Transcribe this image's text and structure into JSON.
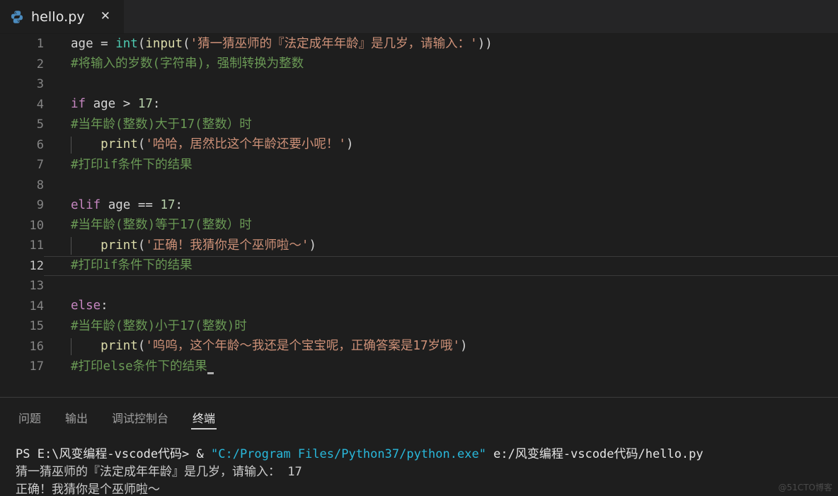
{
  "window": {
    "theme_bg": "#1e1e1e",
    "tabbar_bg": "#252526"
  },
  "tabbar": {
    "tab": {
      "icon": "python-file-icon",
      "label": "hello.py",
      "close_label": "✕"
    }
  },
  "editor": {
    "lines": [
      {
        "n": "1",
        "active": false,
        "indent_guide": false,
        "tokens": [
          {
            "t": "age ",
            "c": "tk-plain"
          },
          {
            "t": "= ",
            "c": "tk-plain"
          },
          {
            "t": "int",
            "c": "tk-fn"
          },
          {
            "t": "(",
            "c": "tk-plain"
          },
          {
            "t": "input",
            "c": "tk-fn2"
          },
          {
            "t": "(",
            "c": "tk-plain"
          },
          {
            "t": "'猜一猜巫师的『法定成年年龄』是几岁，请输入：'",
            "c": "tk-str"
          },
          {
            "t": "))",
            "c": "tk-plain"
          }
        ]
      },
      {
        "n": "2",
        "active": false,
        "indent_guide": false,
        "tokens": [
          {
            "t": "#将输入的岁数(字符串)，强制转换为整数",
            "c": "tk-cmt"
          }
        ]
      },
      {
        "n": "3",
        "active": false,
        "indent_guide": false,
        "tokens": []
      },
      {
        "n": "4",
        "active": false,
        "indent_guide": false,
        "tokens": [
          {
            "t": "if",
            "c": "tk-kw"
          },
          {
            "t": " age ",
            "c": "tk-plain"
          },
          {
            "t": "> ",
            "c": "tk-plain"
          },
          {
            "t": "17",
            "c": "tk-num"
          },
          {
            "t": ":",
            "c": "tk-plain"
          }
        ]
      },
      {
        "n": "5",
        "active": false,
        "indent_guide": false,
        "tokens": [
          {
            "t": "#当年龄(整数)大于17(整数）时",
            "c": "tk-cmt"
          }
        ]
      },
      {
        "n": "6",
        "active": false,
        "indent_guide": true,
        "tokens": [
          {
            "t": "    ",
            "c": "tk-plain"
          },
          {
            "t": "print",
            "c": "tk-fn2"
          },
          {
            "t": "(",
            "c": "tk-plain"
          },
          {
            "t": "'哈哈，居然比这个年龄还要小呢！'",
            "c": "tk-str"
          },
          {
            "t": ")",
            "c": "tk-plain"
          }
        ]
      },
      {
        "n": "7",
        "active": false,
        "indent_guide": false,
        "tokens": [
          {
            "t": "#打印if条件下的结果",
            "c": "tk-cmt"
          }
        ]
      },
      {
        "n": "8",
        "active": false,
        "indent_guide": false,
        "tokens": []
      },
      {
        "n": "9",
        "active": false,
        "indent_guide": false,
        "tokens": [
          {
            "t": "elif",
            "c": "tk-kw"
          },
          {
            "t": " age ",
            "c": "tk-plain"
          },
          {
            "t": "== ",
            "c": "tk-plain"
          },
          {
            "t": "17",
            "c": "tk-num"
          },
          {
            "t": ":",
            "c": "tk-plain"
          }
        ]
      },
      {
        "n": "10",
        "active": false,
        "indent_guide": false,
        "tokens": [
          {
            "t": "#当年龄(整数)等于17(整数）时",
            "c": "tk-cmt"
          }
        ]
      },
      {
        "n": "11",
        "active": false,
        "indent_guide": true,
        "tokens": [
          {
            "t": "    ",
            "c": "tk-plain"
          },
          {
            "t": "print",
            "c": "tk-fn2"
          },
          {
            "t": "(",
            "c": "tk-plain"
          },
          {
            "t": "'正确！我猜你是个巫师啦～'",
            "c": "tk-str"
          },
          {
            "t": ")",
            "c": "tk-plain"
          }
        ]
      },
      {
        "n": "12",
        "active": true,
        "indent_guide": false,
        "tokens": [
          {
            "t": "#打印if条件下的结果",
            "c": "tk-cmt"
          }
        ]
      },
      {
        "n": "13",
        "active": false,
        "indent_guide": false,
        "tokens": []
      },
      {
        "n": "14",
        "active": false,
        "indent_guide": false,
        "tokens": [
          {
            "t": "else",
            "c": "tk-kw"
          },
          {
            "t": ":",
            "c": "tk-plain"
          }
        ]
      },
      {
        "n": "15",
        "active": false,
        "indent_guide": false,
        "tokens": [
          {
            "t": "#当年龄(整数)小于17(整数)时",
            "c": "tk-cmt"
          }
        ]
      },
      {
        "n": "16",
        "active": false,
        "indent_guide": true,
        "tokens": [
          {
            "t": "    ",
            "c": "tk-plain"
          },
          {
            "t": "print",
            "c": "tk-fn2"
          },
          {
            "t": "(",
            "c": "tk-plain"
          },
          {
            "t": "'呜呜，这个年龄～我还是个宝宝呢，正确答案是17岁哦'",
            "c": "tk-str"
          },
          {
            "t": ")",
            "c": "tk-plain"
          }
        ]
      },
      {
        "n": "17",
        "active": false,
        "indent_guide": false,
        "caret": true,
        "tokens": [
          {
            "t": "#打印else条件下的结果",
            "c": "tk-cmt"
          }
        ]
      }
    ]
  },
  "panel": {
    "tabs": [
      {
        "label": "问题",
        "active": false
      },
      {
        "label": "输出",
        "active": false
      },
      {
        "label": "调试控制台",
        "active": false
      },
      {
        "label": "终端",
        "active": true
      }
    ],
    "terminal": {
      "lines": [
        {
          "parts": [
            {
              "t": "PS E:\\风变编程-vscode代码> & ",
              "c": "t-white"
            },
            {
              "t": "\"C:/Program Files/Python37/python.exe\"",
              "c": "t-cyan"
            },
            {
              "t": " e:/风变编程-vscode代码/hello.py",
              "c": "t-white"
            }
          ]
        },
        {
          "parts": [
            {
              "t": "猜一猜巫师的『法定成年年龄』是几岁，请输入： 17",
              "c": "t-gray"
            }
          ]
        },
        {
          "parts": [
            {
              "t": "正确！我猜你是个巫师啦～",
              "c": "t-gray"
            }
          ]
        }
      ]
    }
  },
  "watermark": {
    "text": "@51CTO博客"
  }
}
